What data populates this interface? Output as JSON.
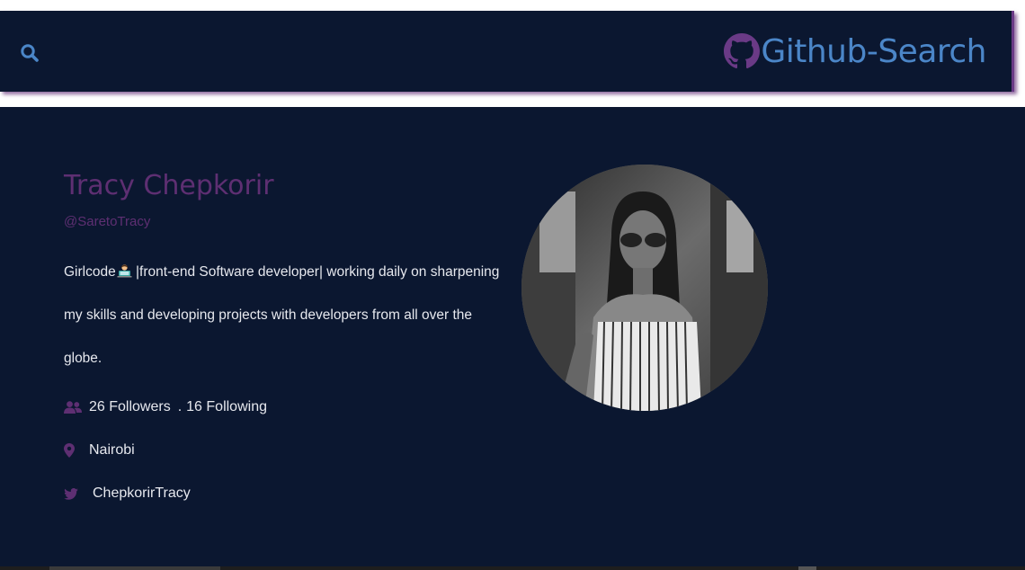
{
  "navbar": {
    "search_icon": "search-icon",
    "brand_icon": "github-icon",
    "brand_title": "Github-Search"
  },
  "profile": {
    "name": "Tracy Chepkorir",
    "login": "@SaretoTracy",
    "bio_prefix": "Girlcode",
    "bio_emoji": "woman-technologist-emoji",
    "bio_rest": " |front-end Software developer| working daily on sharpening my skills and developing projects with developers from all over the globe.",
    "followers": "26 Followers",
    "separator": ".",
    "following": "16 Following",
    "location": "Nairobi",
    "twitter": "ChepkorirTracy",
    "avatar_description": "avatar-photo"
  },
  "colors": {
    "background": "#0b1730",
    "accent_purple": "#5e2f72",
    "brand_blue": "#4b86c8",
    "text_light": "#e6e8ee"
  }
}
